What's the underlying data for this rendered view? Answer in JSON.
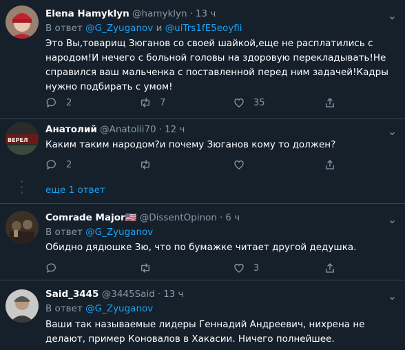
{
  "tweets": [
    {
      "name": "Elena Hamyklyn",
      "handle": "@hamyklyn",
      "time": "13 ч",
      "reply_prefix": "В ответ",
      "reply_to_1": "@G_Zyuganov",
      "reply_and": "и",
      "reply_to_2": "@uiTrs1fE5eoyfii",
      "text": "Это Вы,товарищ Зюганов со своей шайкой,еще не расплатились с народом!И нечего с больной головы на здоровую перекладывать!Не справился ваш мальченка с поставленной перед ним задачей!Кадры нужно подбирать с умом!",
      "replies": "2",
      "retweets": "7",
      "likes": "35"
    },
    {
      "name": "Анатолий",
      "handle": "@Anatolii70",
      "time": "12 ч",
      "text": "Каким таким народом?и почему Зюганов кому то должен?",
      "replies": "2",
      "retweets": "",
      "likes": ""
    },
    {
      "more_replies": "еще 1 ответ"
    },
    {
      "name": "Comrade Major",
      "flag": "🇺🇸",
      "handle": "@DissentOpinon",
      "time": "6 ч",
      "reply_prefix": "В ответ",
      "reply_to_1": "@G_Zyuganov",
      "text": "Обидно дядюшке Зю, что по бумажке читает другой дедушка.",
      "replies": "",
      "retweets": "",
      "likes": "3"
    },
    {
      "name": "Said_3445",
      "handle": "@3445Said",
      "time": "13 ч",
      "reply_prefix": "В ответ",
      "reply_to_1": "@G_Zyuganov",
      "text": "Ваши так называемые лидеры Геннадий Андреевич, нихрена не делают, пример Коновалов в Хакасии. Ничего полнейшее."
    }
  ],
  "icons": {
    "reply": "reply-icon",
    "retweet": "retweet-icon",
    "like": "like-icon",
    "share": "share-icon",
    "more": "more-icon"
  },
  "colors": {
    "background": "#15202b",
    "secondary_text": "#8899a6",
    "link": "#1da1f2",
    "separator": "#38444d"
  }
}
